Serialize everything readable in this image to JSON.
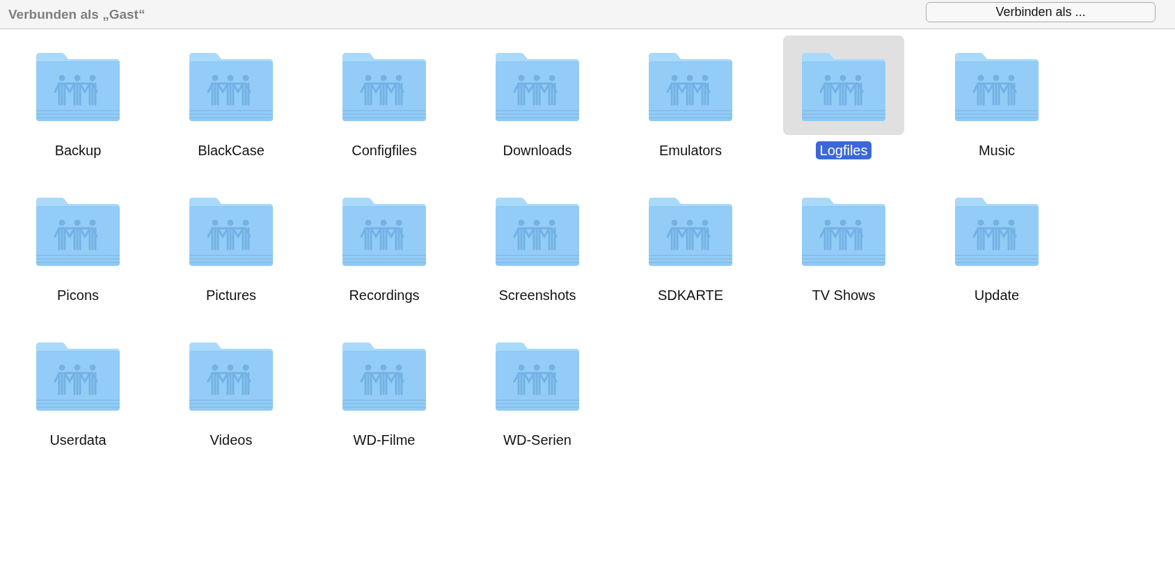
{
  "header": {
    "title": "Verbunden als „Gast“",
    "button": "Verbinden als ..."
  },
  "folders": [
    {
      "name": "Backup",
      "selected": false
    },
    {
      "name": "BlackCase",
      "selected": false
    },
    {
      "name": "Configfiles",
      "selected": false
    },
    {
      "name": "Downloads",
      "selected": false
    },
    {
      "name": "Emulators",
      "selected": false
    },
    {
      "name": "Logfiles",
      "selected": true
    },
    {
      "name": "Music",
      "selected": false
    },
    {
      "name": "Picons",
      "selected": false
    },
    {
      "name": "Pictures",
      "selected": false
    },
    {
      "name": "Recordings",
      "selected": false
    },
    {
      "name": "Screenshots",
      "selected": false
    },
    {
      "name": "SDKARTE",
      "selected": false
    },
    {
      "name": "TV Shows",
      "selected": false
    },
    {
      "name": "Update",
      "selected": false
    },
    {
      "name": "Userdata",
      "selected": false
    },
    {
      "name": "Videos",
      "selected": false
    },
    {
      "name": "WD-Filme",
      "selected": false
    },
    {
      "name": "WD-Serien",
      "selected": false
    }
  ]
}
